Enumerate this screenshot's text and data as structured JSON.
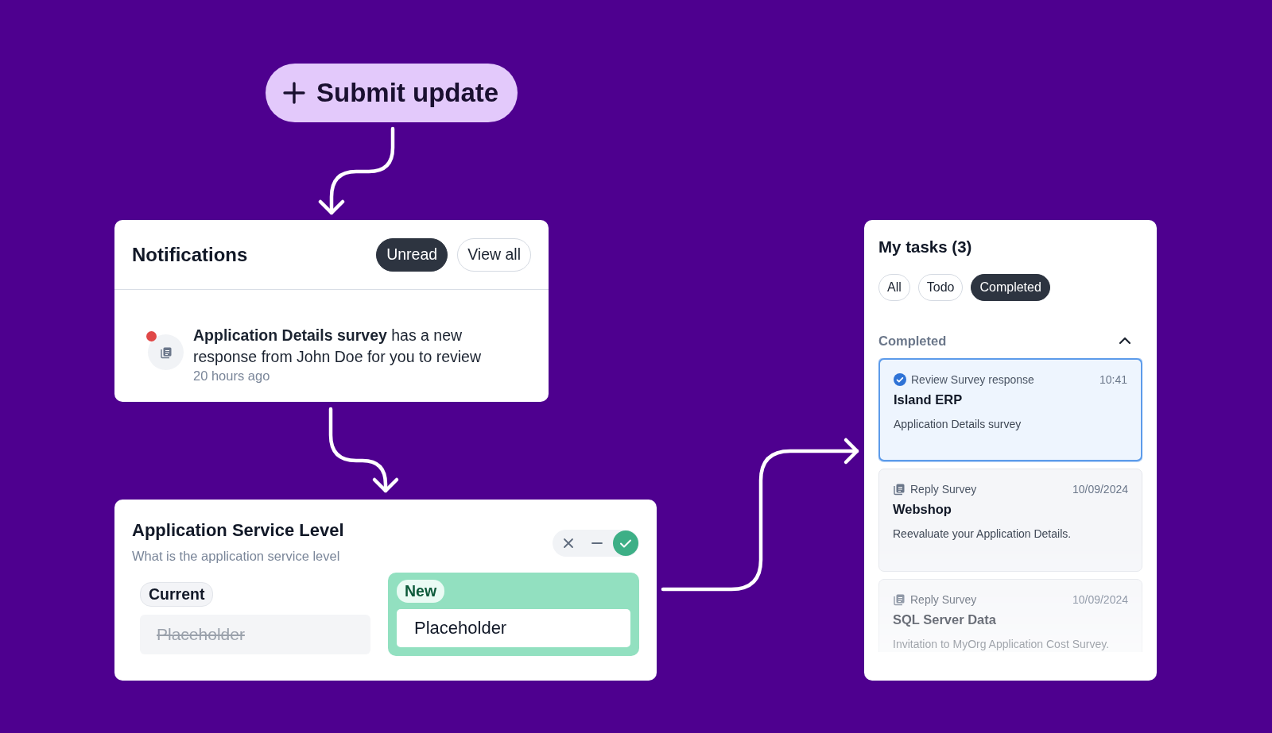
{
  "submit_button": {
    "label": "Submit update"
  },
  "notifications": {
    "title": "Notifications",
    "filters": [
      {
        "label": "Unread",
        "selected": true
      },
      {
        "label": "View all",
        "selected": false
      }
    ],
    "items": [
      {
        "text": "**Application Details survey** has a new response from John Doe for you to review",
        "time": "20 hours ago",
        "unread": true
      }
    ]
  },
  "service_level": {
    "title": "Application Service Level",
    "subtitle": "What is the application service level",
    "options": [
      {
        "kind": "reject",
        "selected": false
      },
      {
        "kind": "neutral",
        "selected": false
      },
      {
        "kind": "accept",
        "selected": true
      }
    ],
    "current": {
      "label": "Current",
      "value": "Placeholder",
      "struck": true
    },
    "new": {
      "label": "New",
      "value": "Placeholder"
    }
  },
  "tasks": {
    "title": "My tasks (3)",
    "filters": [
      {
        "label": "All",
        "selected": false
      },
      {
        "label": "Todo",
        "selected": false
      },
      {
        "label": "Completed",
        "selected": true
      }
    ],
    "section": {
      "title": "Completed",
      "expanded": true
    },
    "items": [
      {
        "kind": "done",
        "type": "Review Survey response",
        "time": "10:41",
        "title": "Island ERP",
        "description": "Application Details survey",
        "selected": true
      },
      {
        "kind": "survey",
        "type": "Reply Survey",
        "time": "10/09/2024",
        "title": "Webshop",
        "description": "Reevaluate your Application Details.",
        "selected": false
      },
      {
        "kind": "survey",
        "type": "Reply Survey",
        "time": "10/09/2024",
        "title": "SQL Server Data",
        "description": "Invitation to MyOrg Application Cost Survey.",
        "selected": false
      }
    ]
  }
}
